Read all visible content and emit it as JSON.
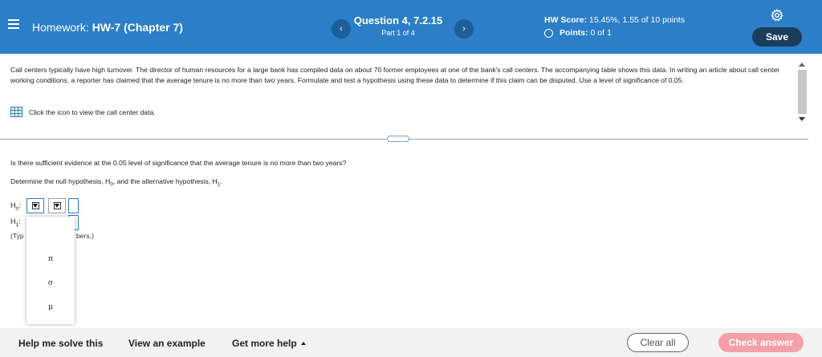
{
  "header": {
    "menu_icon": "hamburger-icon",
    "homework_prefix": "Homework:",
    "homework_name": "HW-7 (Chapter 7)",
    "prev_label": "‹",
    "next_label": "›",
    "question_title": "Question 4, 7.2.15",
    "question_part": "Part 1 of 4",
    "hw_score_label": "HW Score:",
    "hw_score_value": "15.45%, 1.55 of 10 points",
    "points_label": "Points:",
    "points_value": "0 of 1",
    "settings_icon": "gear-icon",
    "save_label": "Save",
    "accent_color": "#2b7ec7"
  },
  "problem": {
    "text": "Call centers typically have high turnover. The director of human resources for a large bank has compiled data on about 70 former employees at one of the bank's call centers. The accompanying table shows this data. In writing an article about call center working conditions, a reporter has claimed that the average tenure is no more than two years. Formulate and test a hypothesis using these data to determine if this claim can be disputed. Use a level of significance of 0.05.",
    "data_link_icon": "table-grid-icon",
    "data_link_text": "Click the icon to view the call center data."
  },
  "divider_handle": "·····",
  "question": {
    "text": "Is there sufficient evidence at the 0.05 level of significance that the average tenure is no more than two years?",
    "determine_prefix": "Determine the null hypothesis, H",
    "determine_mid": ", and the alternative hypothesis, H",
    "determine_end": ".",
    "sub0": "0",
    "sub1": "1",
    "h0_label": "H",
    "h0_sub": "0",
    "h1_label": "H",
    "h1_sub": "1",
    "type_hint_start": "(Typ",
    "type_hint_end": "bers.)"
  },
  "dropdown": {
    "options": [
      "π",
      "σ",
      "μ"
    ]
  },
  "footer": {
    "help_solve": "Help me solve this",
    "view_example": "View an example",
    "more_help": "Get more help",
    "clear_all": "Clear all",
    "check_answer": "Check answer",
    "check_color": "#f4a0a8"
  }
}
